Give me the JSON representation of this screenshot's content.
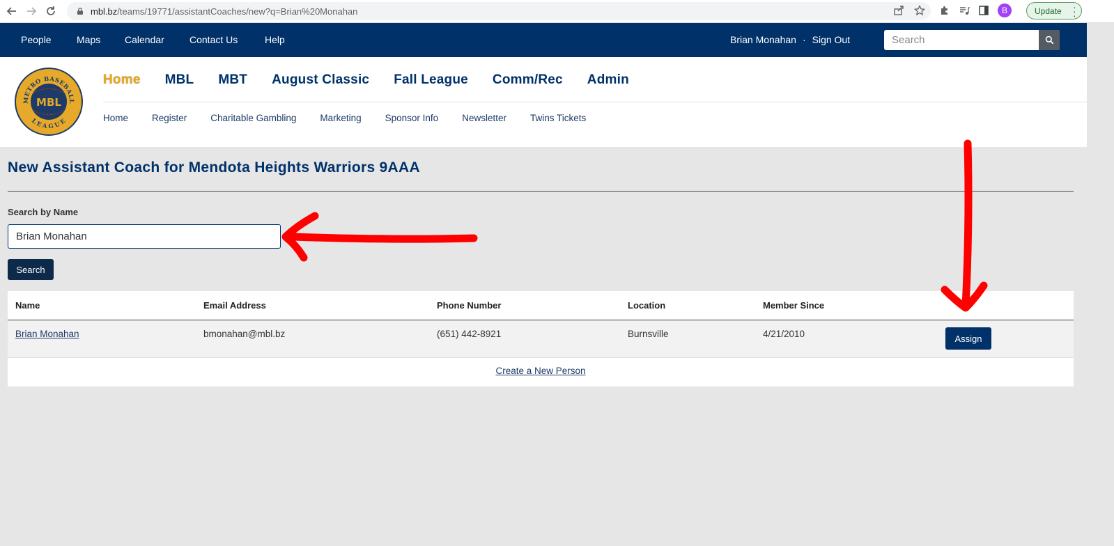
{
  "browser": {
    "url_host": "mbl.bz",
    "url_path": "/teams/19771/assistantCoaches/new?q=Brian%20Monahan",
    "profile_initial": "B",
    "update_label": "Update"
  },
  "topbar": {
    "links": [
      "People",
      "Maps",
      "Calendar",
      "Contact Us",
      "Help"
    ],
    "user_name": "Brian Monahan",
    "separator": "·",
    "sign_out": "Sign Out",
    "search_placeholder": "Search"
  },
  "logo": {
    "arc_top": "METRO BASEBALL",
    "center": "MBL",
    "arc_bottom": "LEAGUE"
  },
  "primary_nav": [
    "Home",
    "MBL",
    "MBT",
    "August Classic",
    "Fall League",
    "Comm/Rec",
    "Admin"
  ],
  "secondary_nav": [
    "Home",
    "Register",
    "Charitable Gambling",
    "Marketing",
    "Sponsor Info",
    "Newsletter",
    "Twins Tickets"
  ],
  "page": {
    "title": "New Assistant Coach for Mendota Heights Warriors 9AAA",
    "search_label": "Search by Name",
    "search_value": "Brian Monahan",
    "search_button": "Search"
  },
  "results": {
    "headers": [
      "Name",
      "Email Address",
      "Phone Number",
      "Location",
      "Member Since"
    ],
    "rows": [
      {
        "name": "Brian Monahan",
        "email": "bmonahan@mbl.bz",
        "phone": "(651) 442-8921",
        "location": "Burnsville",
        "member_since": "4/21/2010",
        "action": "Assign"
      }
    ],
    "create_link": "Create a New Person"
  },
  "colors": {
    "navy": "#003169",
    "gold": "#e6a92a",
    "annotation_red": "#ff0000"
  }
}
